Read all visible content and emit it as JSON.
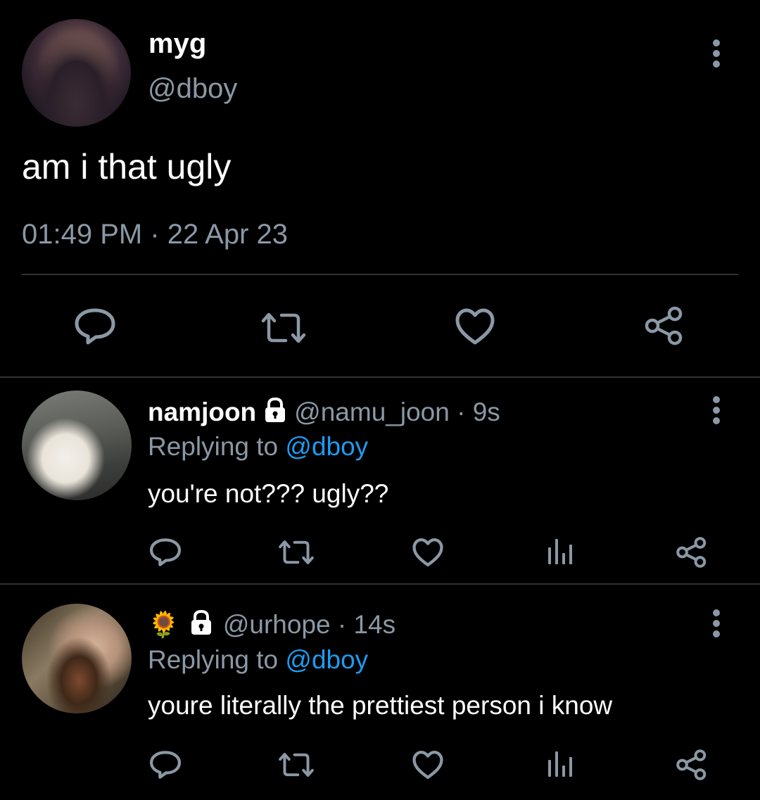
{
  "main_tweet": {
    "display_name": "myg",
    "handle": "@dboy",
    "text": "am i that ugly",
    "timestamp": "01:49 PM · 22 Apr 23",
    "actions": [
      "reply-icon",
      "retweet-icon",
      "like-icon",
      "share-icon"
    ]
  },
  "replies": [
    {
      "display_name": "namjoon",
      "locked": true,
      "handle_time": "@namu_joon · 9s",
      "replying_prefix": "Replying to",
      "replying_to": "@dboy",
      "text": "you're not??? ugly??",
      "actions": [
        "reply-icon",
        "retweet-icon",
        "like-icon",
        "analytics-icon",
        "share-icon"
      ]
    },
    {
      "display_name_emoji": "🌻",
      "locked": true,
      "handle_time": "@urhope · 14s",
      "replying_prefix": "Replying to",
      "replying_to": "@dboy",
      "text": "youre literally the prettiest person i know",
      "actions": [
        "reply-icon",
        "retweet-icon",
        "like-icon",
        "analytics-icon",
        "share-icon"
      ]
    }
  ],
  "colors": {
    "background": "#000000",
    "text": "#e7e9ea",
    "secondary": "#8b98a5",
    "link": "#1d9bf0",
    "divider": "#2f3336"
  }
}
